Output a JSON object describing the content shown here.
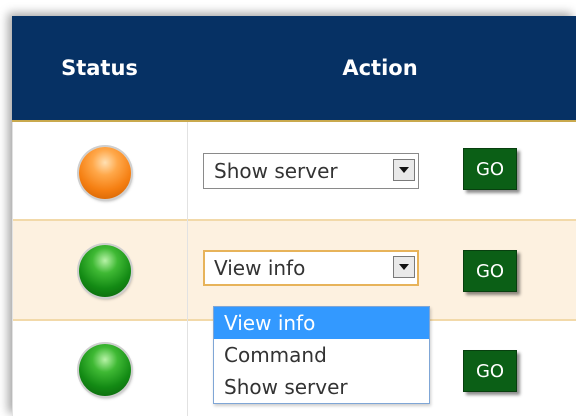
{
  "header": {
    "status_label": "Status",
    "action_label": "Action"
  },
  "rows": [
    {
      "status_color": "orange",
      "action_selected": "Show server",
      "go_label": "GO"
    },
    {
      "status_color": "green",
      "action_selected": "View info",
      "go_label": "GO",
      "dropdown_open": true
    },
    {
      "status_color": "green",
      "action_selected": "",
      "go_label": "GO"
    }
  ],
  "dropdown": {
    "options": [
      "View info",
      "Command",
      "Show server"
    ],
    "highlighted_index": 0
  },
  "colors": {
    "header_bg": "#063164",
    "status_orange": "#f57f12",
    "status_green": "#138a14",
    "go_button": "#0b5f16",
    "highlight": "#3399ff",
    "alt_row": "#fdf1e0"
  },
  "icons": {
    "status_indicator": "status-led-icon",
    "select_arrow": "chevron-down-icon"
  }
}
